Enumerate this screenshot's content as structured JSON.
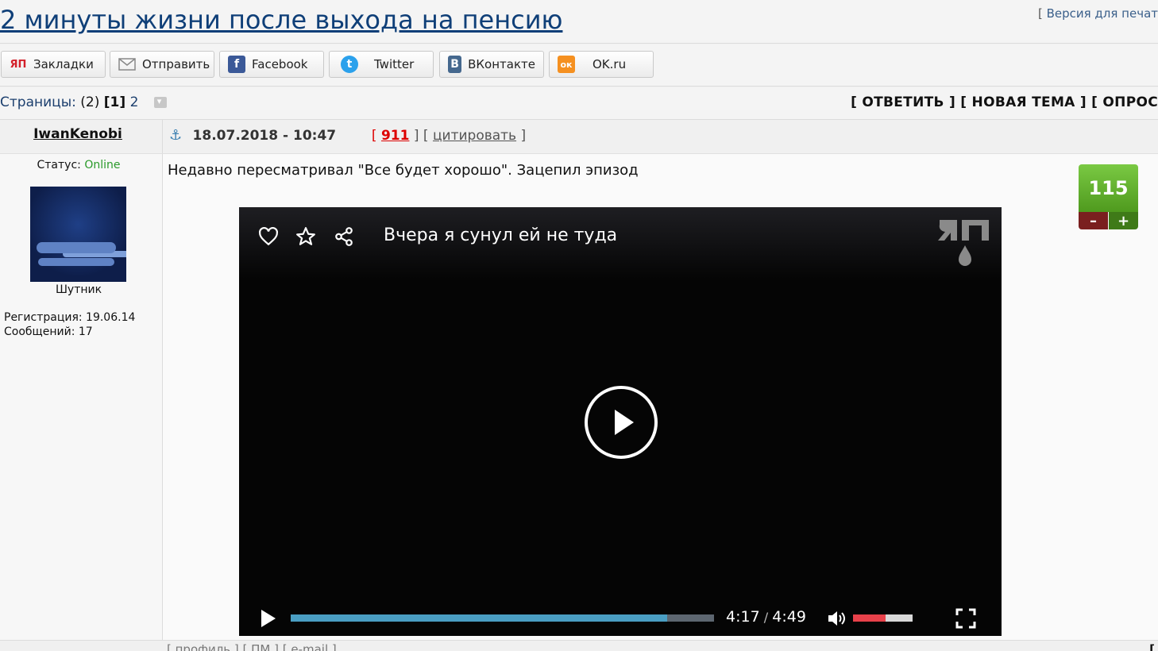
{
  "topic": {
    "title": "2 минуты жизни после выхода на пенсию",
    "print_open": "[ ",
    "print_link": "Версия для печат"
  },
  "share": {
    "bookmarks": {
      "label": "Закладки",
      "icon_text": "ЯП",
      "color": "#d3202a"
    },
    "send": {
      "label": "Отправить"
    },
    "facebook": {
      "label": "Facebook",
      "icon_text": "f",
      "color": "#3b5998"
    },
    "twitter": {
      "label": "Twitter",
      "icon_text": "t",
      "color": "#2ba1ec"
    },
    "vk": {
      "label": "ВКонтакте",
      "icon_text": "В",
      "color": "#45688e"
    },
    "ok": {
      "label": "OK.ru",
      "icon_text": "ок",
      "color": "#f59020"
    }
  },
  "pagination": {
    "label": "Страницы:",
    "count": "(2)",
    "current": "[1]",
    "next": "2",
    "actions": "[ ОТВЕТИТЬ ] [ НОВАЯ ТЕМА ] [ ОПРОС"
  },
  "post": {
    "author": "IwanKenobi",
    "date": "18.07.2018 - 10:47",
    "number_open": "[ ",
    "number": "911",
    "number_close": " ] [ ",
    "quote": "цитировать",
    "quote_close": " ]",
    "text": "Недавно пересматривал \"Все будет хорошо\". Зацепил эпизод",
    "rating": "115",
    "rating_minus": "–",
    "rating_plus": "+"
  },
  "user": {
    "status_label": "Статус: ",
    "status_value": "Online",
    "rank": "Шутник",
    "registration": "Регистрация: 19.06.14",
    "messages": "Сообщений: 17"
  },
  "video": {
    "title": "Вчера я сунул ей не туда",
    "current_time": "4:17",
    "separator": " / ",
    "duration": "4:49",
    "progress_fraction": 0.89,
    "volume_fraction": 0.55
  },
  "footer": {
    "links": "[ профиль ] [ ПМ ] [ e-mail ]",
    "right": "["
  }
}
